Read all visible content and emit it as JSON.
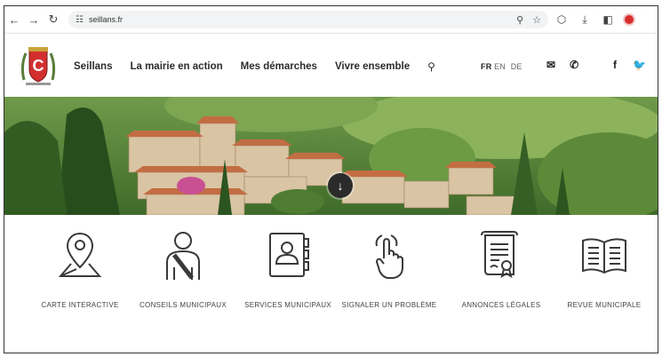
{
  "browser": {
    "url": "seillans.fr"
  },
  "header": {
    "nav": [
      "Seillans",
      "La mairie en action",
      "Mes démarches",
      "Vivre ensemble"
    ],
    "languages": {
      "active": "FR",
      "others": [
        "EN",
        "DE"
      ]
    }
  },
  "services": [
    {
      "label": "CARTE INTERACTIVE",
      "icon": "map-pin-icon"
    },
    {
      "label": "CONSEILS MUNICIPAUX",
      "icon": "person-icon"
    },
    {
      "label": "SERVICES MUNICIPAUX",
      "icon": "contact-book-icon"
    },
    {
      "label": "SIGNALER UN PROBLÈME",
      "icon": "pointing-hand-icon"
    },
    {
      "label": "ANNONCES LÉGALES",
      "icon": "scroll-certificate-icon"
    },
    {
      "label": "REVUE MUNICIPALE",
      "icon": "open-book-icon"
    }
  ],
  "colors": {
    "logo_red": "#d32f2f",
    "icon_stroke": "#3a3a3a"
  }
}
